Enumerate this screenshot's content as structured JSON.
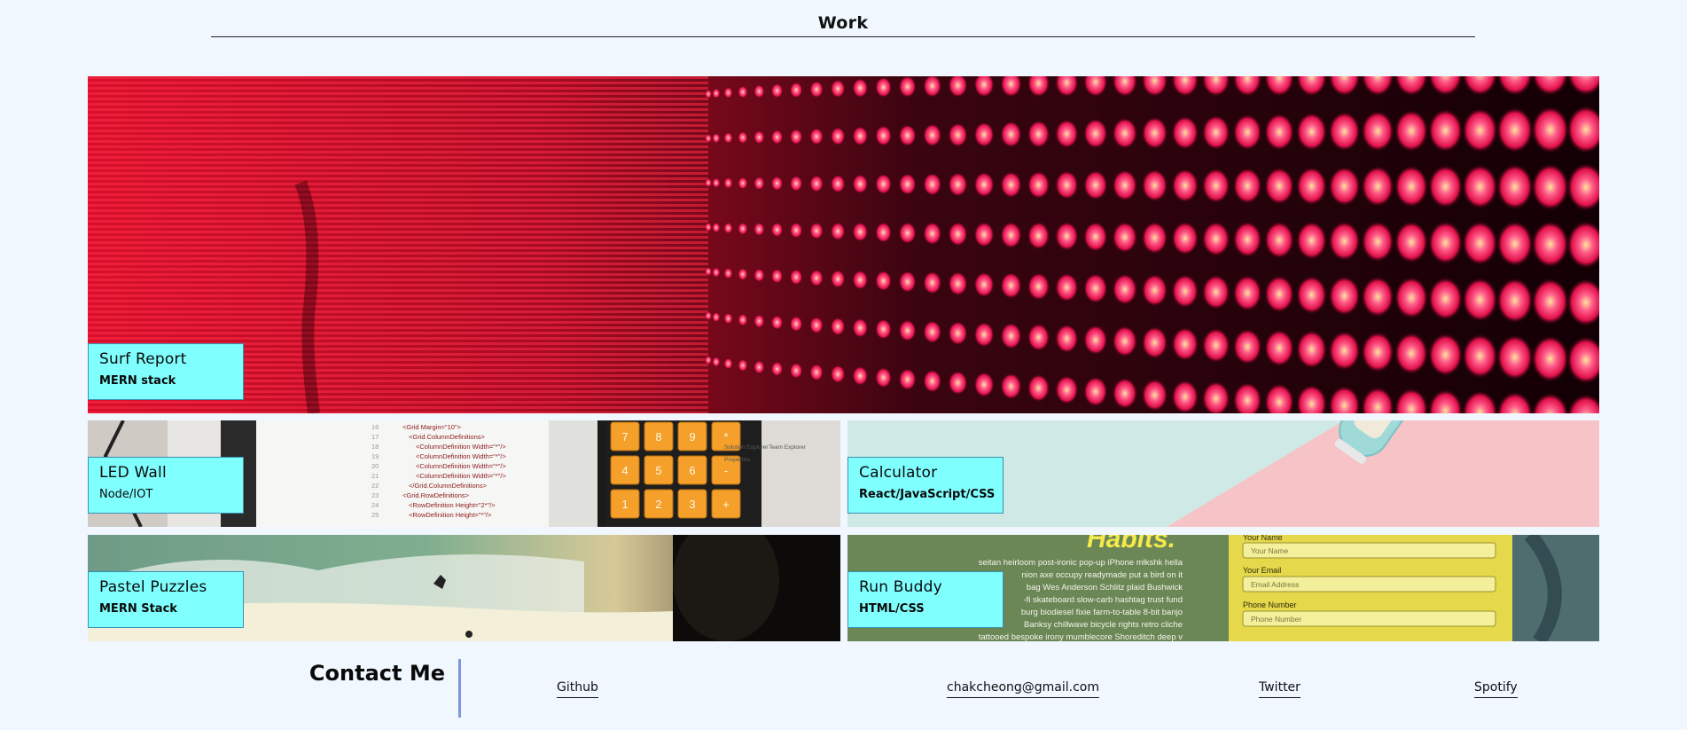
{
  "header": {
    "title": "Work"
  },
  "projects": [
    {
      "title": "Surf Report",
      "subtitle": "MERN stack"
    },
    {
      "title": "LED Wall",
      "subtitle": "Node/IOT"
    },
    {
      "title": "Calculator",
      "subtitle": "React/JavaScript/CSS"
    },
    {
      "title": "Pastel Puzzles",
      "subtitle": "MERN Stack"
    },
    {
      "title": "Run Buddy",
      "subtitle": "HTML/CSS"
    }
  ],
  "run_buddy_preview": {
    "heading": "Habits.",
    "body_lines": [
      "seitan heirloom post-ironic pop-up iPhone mlkshk hella",
      "nion axe occupy readymade put a bird on it",
      "bag Wes Anderson Schlitz plaid Bushwick",
      "-fi skateboard slow-carb hashtag trust fund",
      "burg biodiesel fixie farm-to-table 8-bit banjo",
      "Banksy chillwave bicycle rights retro cliche",
      "tattooed bespoke irony mumblecore Shoreditch deep v"
    ],
    "form": {
      "name_label": "Your Name",
      "name_placeholder": "Your Name",
      "email_label": "Your Email",
      "email_placeholder": "Email Address",
      "phone_label": "Phone Number",
      "phone_placeholder": "Phone Number"
    }
  },
  "led_preview": {
    "code_lines": [
      "<Grid Margin=\"10\">",
      "<Grid.ColumnDefinitions>",
      "<ColumnDefinition Width=\"*\"/>",
      "<ColumnDefinition Width=\"*\"/>",
      "<ColumnDefinition Width=\"*\"/>",
      "<ColumnDefinition Width=\"*\"/>",
      "</Grid.ColumnDefinitions>",
      "<Grid.RowDefinitions>",
      "<RowDefinition Height=\"2*\"/>",
      "<RowDefinition Height=\"*\"/>"
    ],
    "line_numbers": [
      "16",
      "17",
      "18",
      "19",
      "20",
      "21",
      "22",
      "23",
      "24",
      "25"
    ],
    "keys": [
      "7",
      "8",
      "9",
      "*",
      "4",
      "5",
      "6",
      "-",
      "1",
      "2",
      "3",
      "+"
    ],
    "panel_tabs": [
      "Solution Explorer",
      "Team Explorer"
    ],
    "panel_title": "Properties"
  },
  "contact": {
    "heading": "Contact Me",
    "links": {
      "github": "Github",
      "email": "chakcheong@gmail.com",
      "twitter": "Twitter",
      "spotify": "Spotify"
    }
  },
  "colors": {
    "page_background": "#f0f7ff",
    "label_background": "#80ffff",
    "contact_divider": "#7f95e0"
  }
}
